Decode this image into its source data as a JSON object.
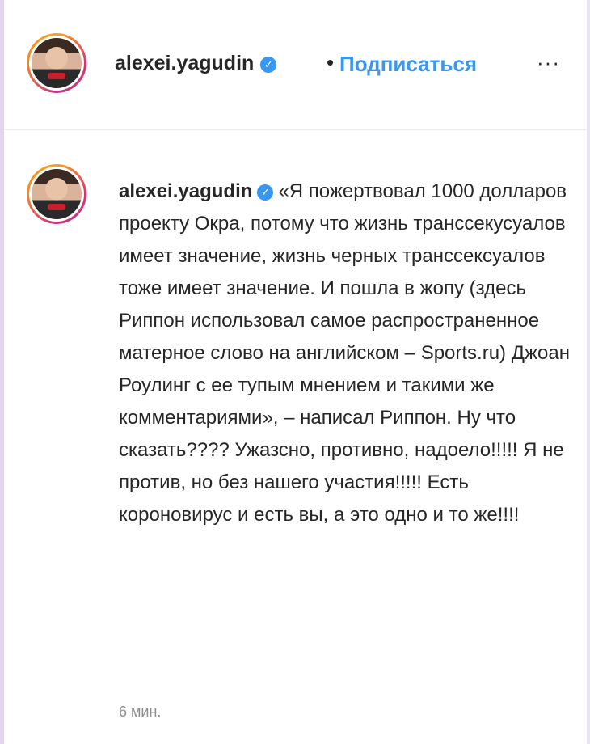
{
  "post_header": {
    "username": "alexei.yagudin",
    "separator": "•",
    "follow_label": "Подписаться",
    "more_label": "···"
  },
  "comment": {
    "username": "alexei.yagudin",
    "text": "«Я пожертвовал 1000 долларов проекту Окра, потому что жизнь транссекусуалов имеет значение, жизнь черных транссексуалов тоже имеет значение. И пошла в жопу (здесь Риппон использовал самое распространенное матерное слово на английском – Sports.ru) Джоан Роулинг с ее тупым мнением и такими же комментариями», – написал Риппон. Ну что сказать???? Ужазсно, противно, надоело!!!!! Я не против, но без нашего участия!!!!! Есть короновирус и есть вы, а это одно и то же!!!!",
    "timestamp": "6 мин."
  },
  "icons": {
    "verified": "verified-badge-icon",
    "more": "more-options-icon"
  },
  "colors": {
    "link_blue": "#3897f0",
    "text": "#262626",
    "muted": "#8e8e8e"
  }
}
